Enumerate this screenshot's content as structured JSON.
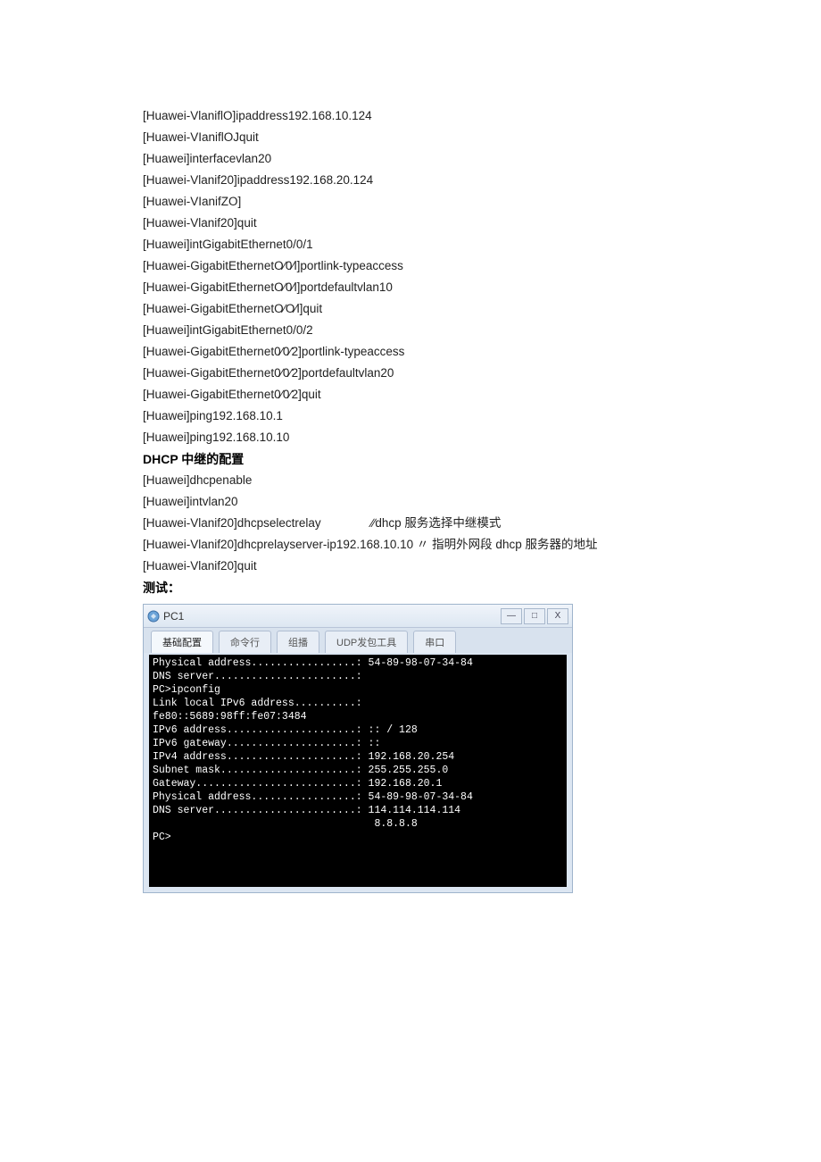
{
  "lines": [
    "[Huawei-VlaniflO]ipaddress192.168.10.124",
    "[Huawei-VIaniflOJquit",
    "[Huawei]interfacevlan20",
    "[Huawei-Vlanif20]ipaddress192.168.20.124",
    "[Huawei-VIanifZO]",
    "[Huawei-Vlanif20]quit",
    "[Huawei]intGigabitEthernet0/0/1",
    "[Huawei-GigabitEthernetO∕0∕l]portlink-typeaccess",
    "[Huawei-GigabitEthernetO∕0∕l]portdefaultvlan10",
    "[Huawei-GigabitEthernetO∕O∕l]quit",
    "[Huawei]intGigabitEthernet0/0/2",
    "[Huawei-GigabitEthernet0∕0∕2]portlink-typeaccess",
    "[Huawei-GigabitEthernet0∕0∕2]portdefaultvlan20",
    "[Huawei-GigabitEthernet0∕0∕2]quit",
    "[Huawei]ping192.168.10.1",
    "[Huawei]ping192.168.10.10"
  ],
  "section1_title": "DHCP 中继的配置",
  "section1_lines": [
    "[Huawei]dhcpenable",
    "[Huawei]intvlan20"
  ],
  "relay_line": "[Huawei-Vlanif20]dhcpselectrelay               ∕∕dhcp 服务选择中继模式",
  "relay_line2": "[Huawei-Vlanif20]dhcprelayserver-ip192.168.10.10 〃 指明外网段 dhcp 服务器的地址",
  "relay_line3": "[Huawei-Vlanif20]quit",
  "test_label": "测试：",
  "window": {
    "title": "PC1",
    "minimize": "—",
    "maximize": "□",
    "close": "X",
    "tabs": [
      "基础配置",
      "命令行",
      "组播",
      "UDP发包工具",
      "串口"
    ]
  },
  "terminal": [
    "Physical address.................: 54-89-98-07-34-84",
    "DNS server.......................:",
    "",
    "PC>ipconfig",
    "",
    "Link local IPv6 address..........:",
    "fe80::5689:98ff:fe07:3484",
    "IPv6 address.....................: :: / 128",
    "IPv6 gateway.....................: ::",
    "IPv4 address.....................: 192.168.20.254",
    "Subnet mask......................: 255.255.255.0",
    "Gateway..........................: 192.168.20.1",
    "Physical address.................: 54-89-98-07-34-84",
    "DNS server.......................: 114.114.114.114",
    "                                    8.8.8.8",
    "",
    "PC>"
  ]
}
